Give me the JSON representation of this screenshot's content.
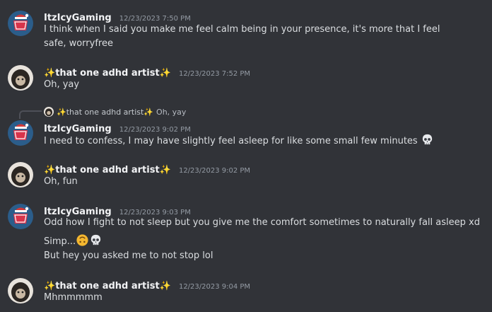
{
  "messages": [
    {
      "author": "ItzIcyGaming",
      "timestamp": "12/23/2023 7:50 PM",
      "lines": [
        "I think when I said you make me feel calm being in your presence, it's more that I feel safe, worryfree"
      ]
    },
    {
      "author_text": "that one adhd artist",
      "author_prefix": "✨",
      "author_suffix": "✨",
      "timestamp": "12/23/2023 7:52 PM",
      "lines": [
        "Oh, yay"
      ]
    },
    {
      "reply_to": {
        "author": "✨that one adhd artist✨",
        "text": "Oh, yay"
      },
      "author": "ItzIcyGaming",
      "timestamp": "12/23/2023 9:02 PM",
      "lines": [
        "I need to confess, I may have slightly feel asleep for like some small few minutes"
      ],
      "emoji": [
        "skull-emoji"
      ]
    },
    {
      "author_text": "that one adhd artist",
      "author_prefix": "✨",
      "author_suffix": "✨",
      "timestamp": "12/23/2023 9:02 PM",
      "lines": [
        "Oh, fun"
      ]
    },
    {
      "author": "ItzIcyGaming",
      "timestamp": "12/23/2023 9:03 PM",
      "lines": [
        "Odd how I fight to not sleep but you give me the comfort sometimes to naturally fall asleep xd",
        "Simp...",
        "But hey you asked me to not stop lol"
      ],
      "emoji": [
        "upside-down-face-emoji",
        "skull-emoji"
      ]
    },
    {
      "author_text": "that one adhd artist",
      "author_prefix": "✨",
      "author_suffix": "✨",
      "timestamp": "12/23/2023 9:04 PM",
      "lines": [
        "Mhmmmmm"
      ]
    }
  ],
  "colors": {
    "background": "#313338",
    "author": "#f2f3f5",
    "timestamp": "#949ba4",
    "text": "#dbdee1",
    "sparkle": "#f7c948"
  }
}
